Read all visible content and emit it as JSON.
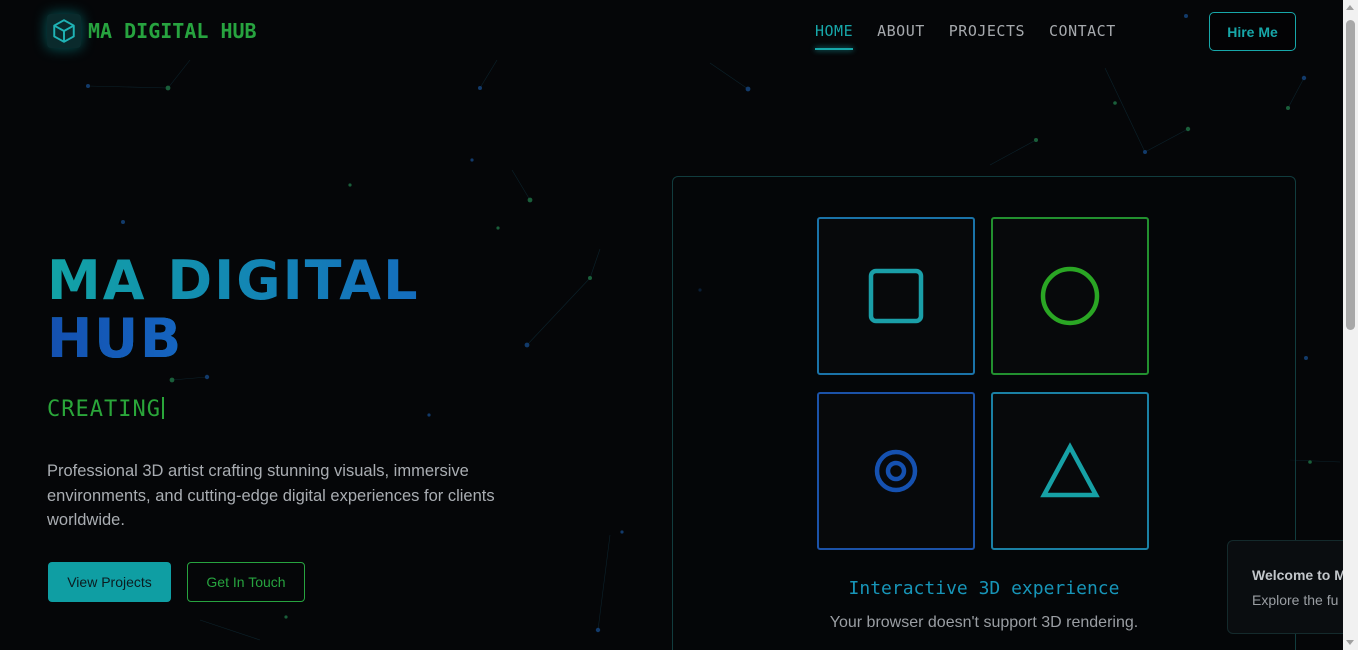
{
  "header": {
    "logo_text": "MA DIGITAL HUB",
    "nav": [
      {
        "label": "HOME",
        "active": true
      },
      {
        "label": "ABOUT",
        "active": false
      },
      {
        "label": "PROJECTS",
        "active": false
      },
      {
        "label": "CONTACT",
        "active": false
      }
    ],
    "hire_label": "Hire Me"
  },
  "hero": {
    "title_line1": "MA DIGITAL",
    "title_line2": "HUB",
    "typing_text": "CREATING",
    "description": "Professional 3D artist crafting stunning visuals, immersive environments, and cutting-edge digital experiences for clients worldwide.",
    "primary_button": "View Projects",
    "secondary_button": "Get In Touch"
  },
  "showcase": {
    "tiles": [
      {
        "icon": "square-icon",
        "color": "#1a9fa8"
      },
      {
        "icon": "circle-icon",
        "color": "#2aa624"
      },
      {
        "icon": "target-icon",
        "color": "#1551b0"
      },
      {
        "icon": "triangle-icon",
        "color": "#16a1a6"
      }
    ],
    "title": "Interactive 3D experience",
    "subtitle": "Your browser doesn't support 3D rendering."
  },
  "toast": {
    "title": "Welcome to M",
    "text": "Explore the fu"
  },
  "colors": {
    "accent_teal": "#17a7a9",
    "accent_green": "#27a33f",
    "accent_blue": "#1565c0",
    "background": "#050608"
  }
}
